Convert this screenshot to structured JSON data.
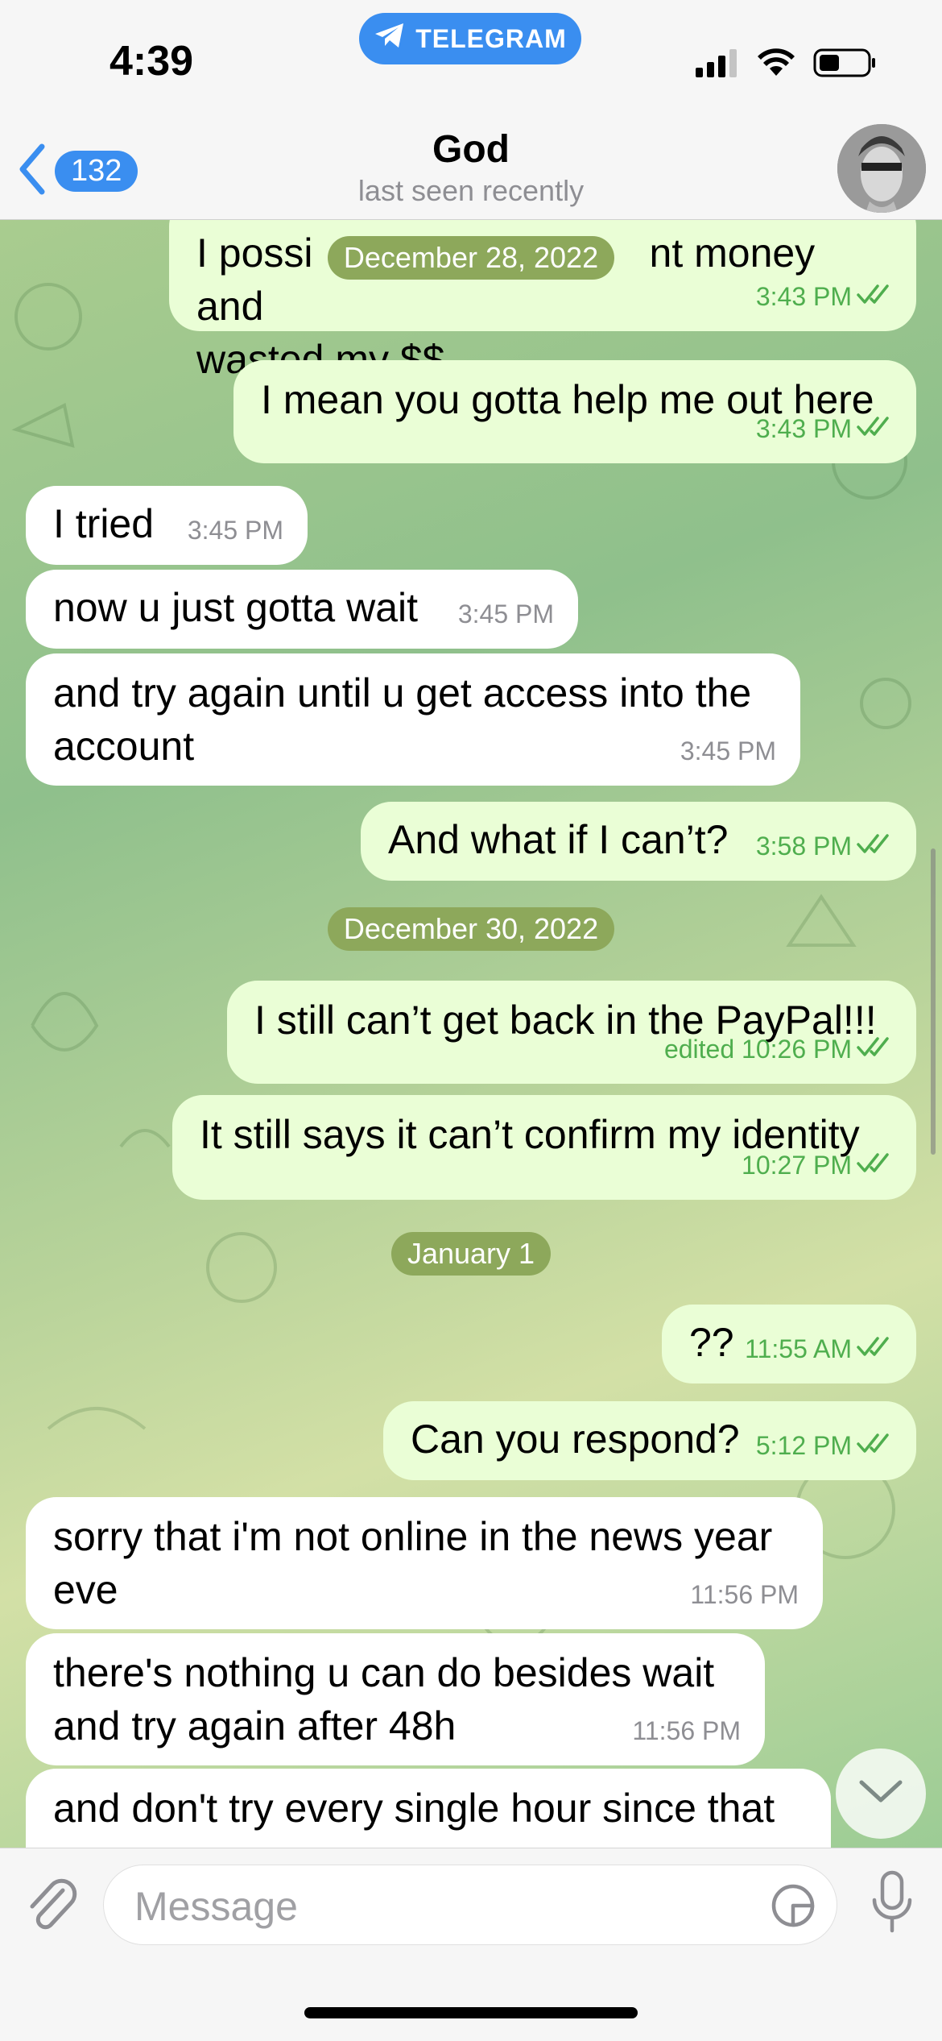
{
  "status": {
    "time": "4:39",
    "source_app": "TELEGRAM"
  },
  "header": {
    "back_count": "132",
    "title": "God",
    "subtitle": "last seen recently"
  },
  "messages": [
    {
      "dir": "out",
      "text": "I possibly sent money and wasted my $$",
      "line1a": "I possi",
      "line1b": "nt money and",
      "line2": "wasted my $$",
      "time": "3:43 PM"
    },
    {
      "dir": "out",
      "text": "I mean you gotta help me out here",
      "time": "3:43 PM"
    },
    {
      "dir": "in",
      "text": "I tried",
      "time": "3:45 PM"
    },
    {
      "dir": "in",
      "text": "now u just gotta wait",
      "time": "3:45 PM"
    },
    {
      "dir": "in",
      "text": "and try again until u get access into the account",
      "line1": "and try again until u get access into the",
      "line2": "account",
      "time": "3:45 PM"
    },
    {
      "dir": "out",
      "text": "And what if I can’t?",
      "time": "3:58 PM"
    },
    {
      "dir": "out",
      "text": "I still can’t get back in the PayPal!!!",
      "time": "edited 10:26 PM"
    },
    {
      "dir": "out",
      "text": "It still says it can’t confirm my identity",
      "time": "10:27 PM"
    },
    {
      "dir": "out",
      "text": "??",
      "time": "11:55 AM"
    },
    {
      "dir": "out",
      "text": "Can you respond?",
      "time": "5:12 PM"
    },
    {
      "dir": "in",
      "text": "sorry that i'm not online in the news year eve",
      "line1": "sorry that i'm not online in the news year",
      "line2": "eve",
      "time": "11:56 PM"
    },
    {
      "dir": "in",
      "text": "there's nothing u can do besides wait and try again after 48h",
      "line1": "there's nothing u can do besides wait",
      "line2": "and try again after 48h",
      "time": "11:56 PM"
    },
    {
      "dir": "in",
      "text": "and don't try every single hour since that",
      "line1": "and don't try every single hour since that"
    }
  ],
  "dates": [
    "December 28, 2022",
    "December 30, 2022",
    "January 1"
  ],
  "input": {
    "placeholder": "Message"
  },
  "colors": {
    "accent": "#3a8ef0",
    "outgoing_bubble": "#eafed6",
    "incoming_bubble": "#ffffff",
    "read_check": "#4fae4e",
    "date_pill": "#8da85b"
  }
}
